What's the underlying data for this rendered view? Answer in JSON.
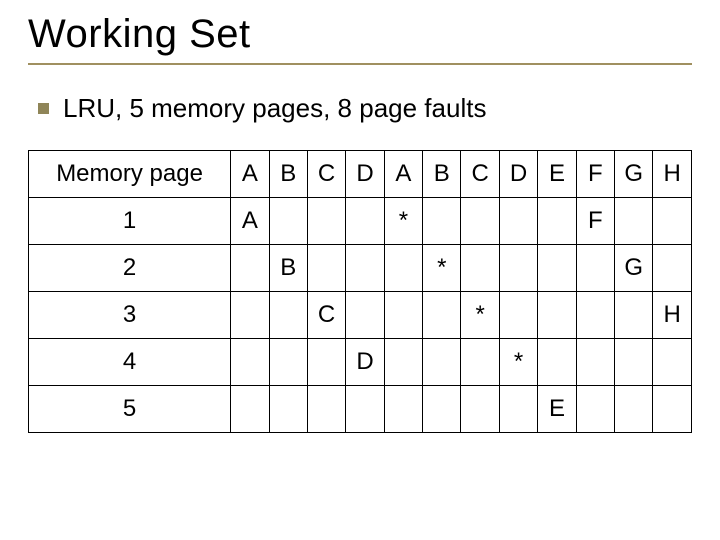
{
  "title": "Working Set",
  "bullet": "LRU, 5 memory pages, 8 page faults",
  "row_header_label": "Memory page",
  "columns": [
    "A",
    "B",
    "C",
    "D",
    "A",
    "B",
    "C",
    "D",
    "E",
    "F",
    "G",
    "H"
  ],
  "rows": [
    {
      "label": "1",
      "cells": [
        "A",
        "",
        "",
        "",
        "*",
        "",
        "",
        "",
        "",
        "F",
        "",
        ""
      ]
    },
    {
      "label": "2",
      "cells": [
        "",
        "B",
        "",
        "",
        "",
        "*",
        "",
        "",
        "",
        "",
        "G",
        ""
      ]
    },
    {
      "label": "3",
      "cells": [
        "",
        "",
        "C",
        "",
        "",
        "",
        "*",
        "",
        "",
        "",
        "",
        "H"
      ]
    },
    {
      "label": "4",
      "cells": [
        "",
        "",
        "",
        "D",
        "",
        "",
        "",
        "*",
        "",
        "",
        "",
        ""
      ]
    },
    {
      "label": "5",
      "cells": [
        "",
        "",
        "",
        "",
        "",
        "",
        "",
        "",
        "E",
        "",
        "",
        ""
      ]
    }
  ]
}
